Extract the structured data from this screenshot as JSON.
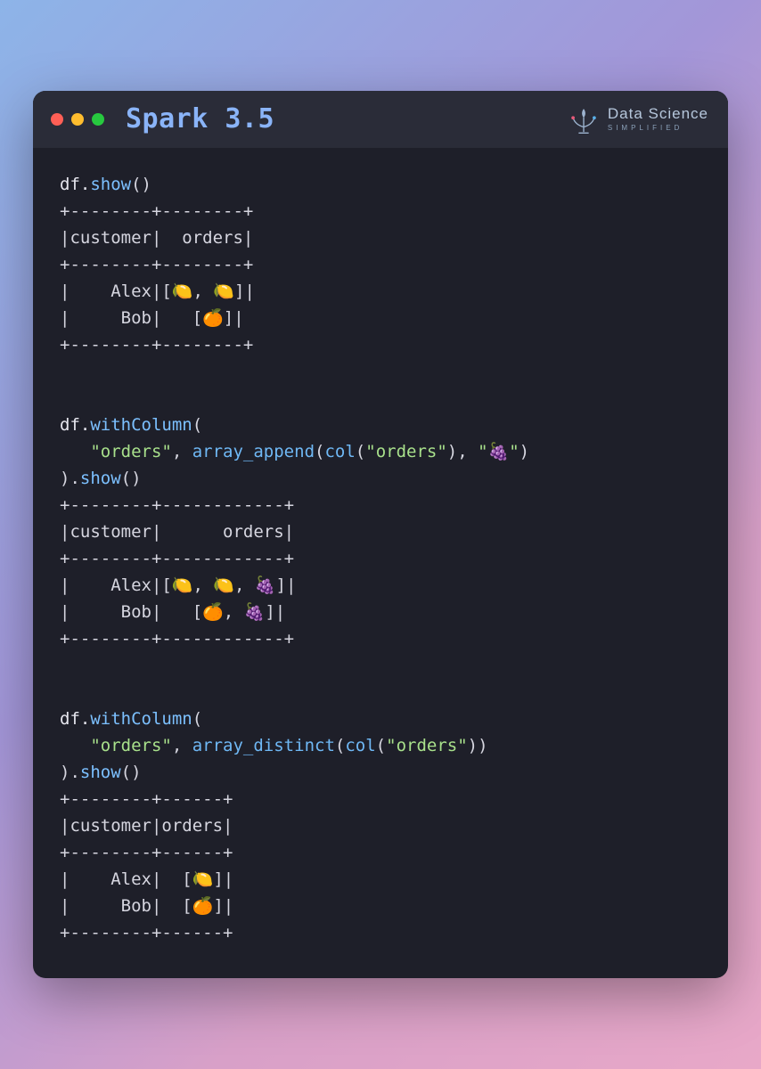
{
  "header": {
    "title": "Spark 3.5",
    "brand_line1": "Data Science",
    "brand_line2": "SIMPLIFIED"
  },
  "code": {
    "block1": {
      "l1_a": "df.",
      "l1_b": "show",
      "l1_c": "()",
      "t1_border": "+--------+--------+",
      "t1_header": "|customer|  orders|",
      "t1_row1": "|    Alex|[🍋, 🍋]|",
      "t1_row2": "|     Bob|   [🍊]|"
    },
    "block2": {
      "l1_a": "df.",
      "l1_b": "withColumn",
      "l1_c": "(",
      "l2_indent": "   ",
      "l2_s1": "\"orders\"",
      "l2_mid": ", ",
      "l2_func": "array_append",
      "l2_open": "(",
      "l2_col": "col",
      "l2_open2": "(",
      "l2_s2": "\"orders\"",
      "l2_close2": "), ",
      "l2_s3": "\"🍇\"",
      "l2_close": ")",
      "l3_a": ").",
      "l3_b": "show",
      "l3_c": "()",
      "t2_border": "+--------+------------+",
      "t2_header": "|customer|      orders|",
      "t2_row1": "|    Alex|[🍋, 🍋, 🍇]|",
      "t2_row2": "|     Bob|   [🍊, 🍇]|"
    },
    "block3": {
      "l1_a": "df.",
      "l1_b": "withColumn",
      "l1_c": "(",
      "l2_indent": "   ",
      "l2_s1": "\"orders\"",
      "l2_mid": ", ",
      "l2_func": "array_distinct",
      "l2_open": "(",
      "l2_col": "col",
      "l2_open2": "(",
      "l2_s2": "\"orders\"",
      "l2_close2": "))",
      "l3_a": ").",
      "l3_b": "show",
      "l3_c": "()",
      "t3_border": "+--------+------+",
      "t3_header": "|customer|orders|",
      "t3_row1": "|    Alex|  [🍋]|",
      "t3_row2": "|     Bob|  [🍊]|"
    }
  }
}
